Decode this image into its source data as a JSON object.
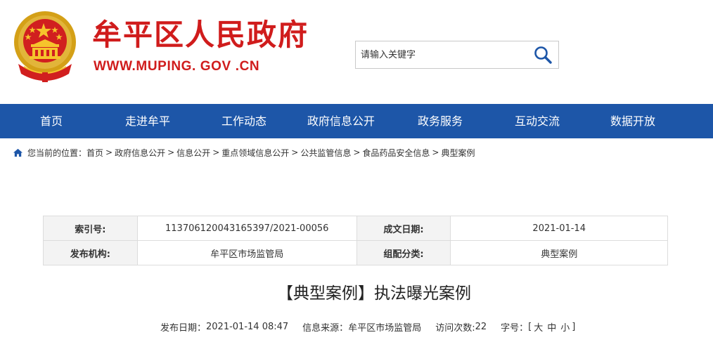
{
  "header": {
    "site_title": "牟平区人民政府",
    "site_domain": "WWW.MUPING. GOV .CN",
    "emblem_icon": "national-emblem-icon",
    "brand_color": "#d01c1c"
  },
  "search": {
    "placeholder": "请输入关键字",
    "icon": "search-icon"
  },
  "nav": {
    "color": "#1d56a8",
    "items": [
      {
        "label": "首页"
      },
      {
        "label": "走进牟平"
      },
      {
        "label": "工作动态"
      },
      {
        "label": "政府信息公开"
      },
      {
        "label": "政务服务"
      },
      {
        "label": "互动交流"
      },
      {
        "label": "数据开放"
      }
    ]
  },
  "breadcrumb": {
    "icon": "home-icon",
    "prefix": "您当前的位置：",
    "items": [
      "首页",
      "政府信息公开",
      "信息公开",
      "重点领域信息公开",
      "公共监管信息",
      "食品药品安全信息",
      "典型案例"
    ],
    "separator": ">"
  },
  "info_table": {
    "rows": [
      [
        {
          "label": "索引号:",
          "value": "113706120043165397/2021-00056"
        },
        {
          "label": "成文日期:",
          "value": "2021-01-14"
        }
      ],
      [
        {
          "label": "发布机构:",
          "value": "牟平区市场监管局"
        },
        {
          "label": "组配分类:",
          "value": "典型案例"
        }
      ]
    ]
  },
  "article": {
    "title": "【典型案例】执法曝光案例",
    "meta": {
      "date_label": "发布日期：",
      "date_value": "2021-01-14 08:47",
      "source_label": "信息来源：",
      "source_value": "牟平区市场监管局",
      "visits_label": "访问次数:",
      "visits_value": "22",
      "font_label": "字号：",
      "font_open": "[",
      "font_large": "大",
      "font_medium": "中",
      "font_small": "小",
      "font_close": "]"
    }
  }
}
